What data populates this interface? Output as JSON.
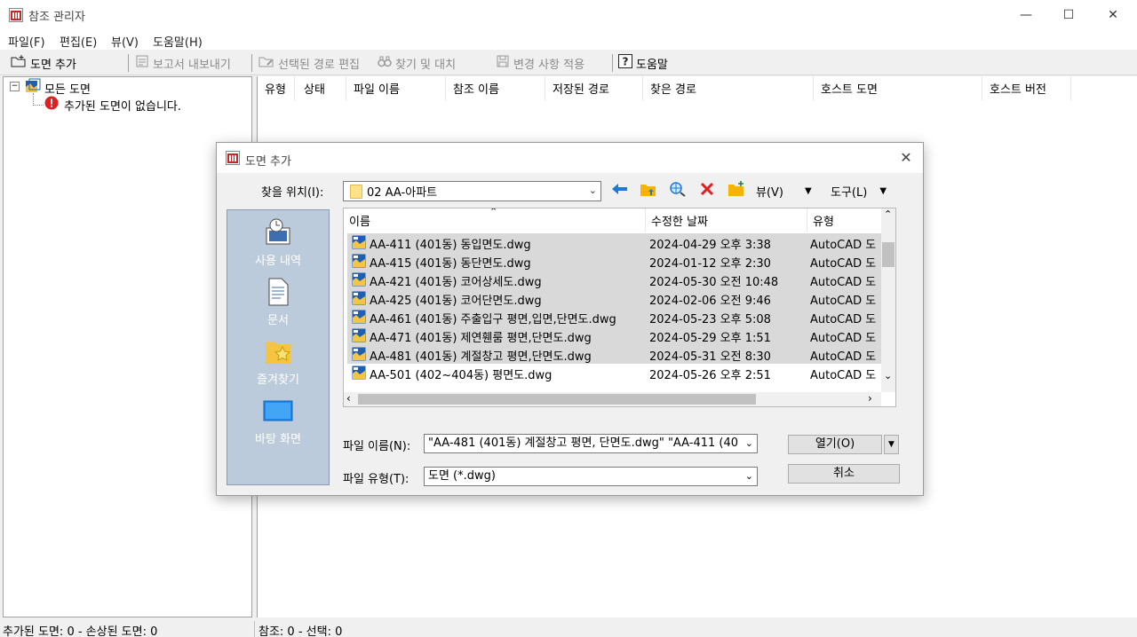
{
  "window": {
    "title": "참조 관리자",
    "controls": {
      "minimize": "—",
      "maximize": "☐",
      "close": "✕"
    }
  },
  "menu": [
    "파일(F)",
    "편집(E)",
    "뷰(V)",
    "도움말(H)"
  ],
  "toolbar": {
    "add_drawing": "도면 추가",
    "export_report": "보고서 내보내기",
    "edit_path": "선택된 경로 편집",
    "find_replace": "찾기 및 대치",
    "apply_changes": "변경 사항 적용",
    "help": "도움말"
  },
  "tree": {
    "root": "모든 도면",
    "empty_msg": "추가된 도면이 없습니다.",
    "toggle": "−"
  },
  "columns": [
    "유형",
    "상태",
    "파일 이름",
    "참조 이름",
    "저장된 경로",
    "찾은 경로",
    "호스트 도면",
    "호스트 버전"
  ],
  "status": {
    "left": "추가된 도면: 0  -  손상된 도면: 0",
    "right": "참조: 0  -  선택: 0"
  },
  "dialog": {
    "title": "도면 추가",
    "close": "✕",
    "look_in_label": "찾을 위치(I):",
    "look_in_value": "02 AA-아파트",
    "view_label": "뷰(V)",
    "tools_label": "도구(L)",
    "places": [
      "사용 내역",
      "문서",
      "즐겨찾기",
      "바탕 화면"
    ],
    "file_headers": [
      "이름",
      "수정한 날짜",
      "유형"
    ],
    "files": [
      {
        "name": "AA-411 (401동) 동입면도.dwg",
        "date": "2024-04-29 오후 3:38",
        "type": "AutoCAD 도",
        "selected": true
      },
      {
        "name": "AA-415 (401동) 동단면도.dwg",
        "date": "2024-01-12 오후 2:30",
        "type": "AutoCAD 도",
        "selected": true
      },
      {
        "name": "AA-421 (401동) 코어상세도.dwg",
        "date": "2024-05-30 오전 10:48",
        "type": "AutoCAD 도",
        "selected": true
      },
      {
        "name": "AA-425 (401동) 코어단면도.dwg",
        "date": "2024-02-06 오전 9:46",
        "type": "AutoCAD 도",
        "selected": true
      },
      {
        "name": "AA-461 (401동) 주출입구 평면,입면,단면도.dwg",
        "date": "2024-05-23 오후 5:08",
        "type": "AutoCAD 도",
        "selected": true
      },
      {
        "name": "AA-471 (401동) 제연휀룸 평면,단면도.dwg",
        "date": "2024-05-29 오후 1:51",
        "type": "AutoCAD 도",
        "selected": true
      },
      {
        "name": "AA-481 (401동) 계절창고 평면,단면도.dwg",
        "date": "2024-05-31 오전 8:30",
        "type": "AutoCAD 도",
        "selected": true
      },
      {
        "name": "AA-501 (402~404동) 평면도.dwg",
        "date": "2024-05-26 오후 2:51",
        "type": "AutoCAD 도",
        "selected": false
      }
    ],
    "filename_label": "파일 이름(N):",
    "filename_value": "\"AA-481 (401동) 계절창고 평면, 단면도.dwg\" \"AA-411 (40",
    "filetype_label": "파일 유형(T):",
    "filetype_value": "도면 (*.dwg)",
    "open_label": "열기(O)",
    "cancel_label": "취소"
  },
  "colors": {
    "selection": "#d9d9d9",
    "places_bg": "#bccbdb",
    "accent_blue": "#1e78d7",
    "delete_red": "#e02020"
  }
}
